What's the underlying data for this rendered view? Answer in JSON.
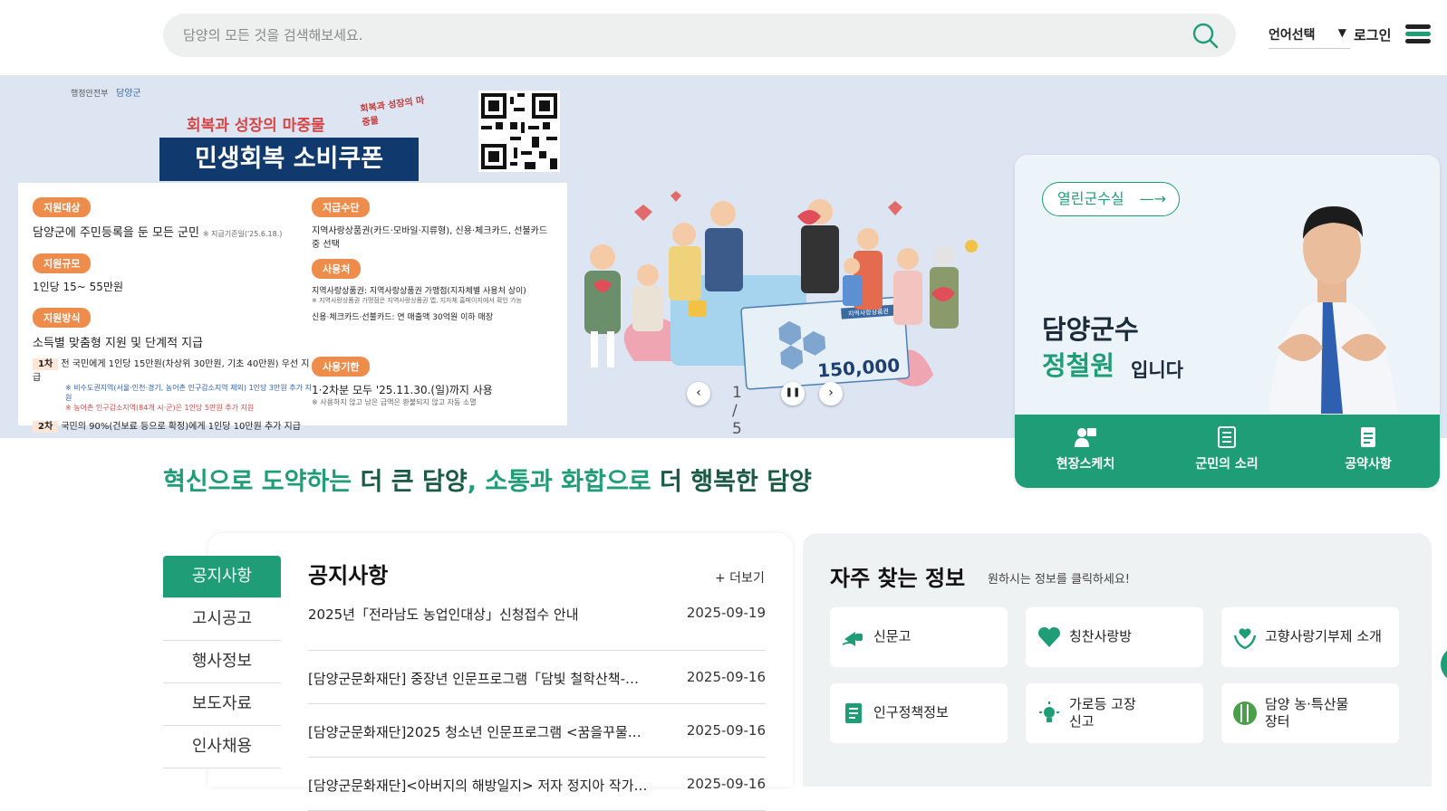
{
  "header": {
    "search_placeholder": "담양의 모든 것을 검색해보세요.",
    "lang_label": "언어선택",
    "lang_arrow": "▼",
    "login_label": "로그인"
  },
  "hero": {
    "poster": {
      "logo_ministry": "행정안전부",
      "logo_county": "담양군",
      "slogan": "회복과 성장의 마중물",
      "tagline": "회복과 성장의 마중물",
      "title": "민생회복 소비쿠폰",
      "sections": {
        "target": {
          "chip": "지원대상",
          "text": "담양군에 주민등록을 둔 모든 군민",
          "note": "※ 지급기준일('25.6.18.)"
        },
        "scale": {
          "chip": "지원규모",
          "text": "1인당 15~ 55만원"
        },
        "method": {
          "chip": "지원방식",
          "text": "소득별 맞춤형 지원 및 단계적 지급",
          "r1_tag": "1차",
          "r1_text": "전 국민에게 1인당 15만원(차상위 30만원, 기초 40만원) 우선 지급",
          "r1_note1": "※ 비수도권지역(서울·인천·경기, 농어촌 인구감소지역 제외) 1인당 3만원 추가 지원",
          "r1_note2": "※ 농어촌 인구감소지역(84개 시·군)은 1인당 5만원 추가 지원",
          "r2_tag": "2차",
          "r2_text": "국민의 90%(건보료 등으로 확정)에게 1인당 10만원 추가 지급"
        },
        "means": {
          "chip": "지급수단",
          "text": "지역사랑상품권(카드·모바일·지류형), 신용·체크카드, 선불카드 중 선택"
        },
        "usage": {
          "chip": "사용처",
          "l1": "지역사랑상품권: 지역사랑상품권 가맹점(지자체별 사용처 상이)",
          "l1_note": "※ 지역사랑상품권 가맹점은 지역사랑상품권 앱, 지자체 홈페이지에서 확인 가능",
          "l2": "신용·체크카드·선불카드: 연 매출액 30억원 이하 매장"
        },
        "period": {
          "chip": "사용기한",
          "text": "1·2차분 모두 '25.11.30.(일)까지 사용",
          "note": "※ 사용하지 않고 남은 금액은 환불되지 않고 자동 소멸"
        }
      }
    },
    "voucher": {
      "label": "지역사랑상품권",
      "amount": "150,000"
    },
    "counter": "1 / 5",
    "prev": "‹",
    "next": "›",
    "pause": "❚❚"
  },
  "mayor": {
    "pill": "열린군수실",
    "pill_arrow": "—→",
    "line1": "담양군수",
    "name": "정철원",
    "suffix": "입니다",
    "buttons": [
      "현장스케치",
      "군민의 소리",
      "공약사항"
    ]
  },
  "slogan": {
    "part1": "혁신으로 도약하는 ",
    "part2": "더 큰 담양",
    "part3": ", 소통과 화합으로 ",
    "part4": "더 행복한 담양"
  },
  "notice": {
    "tabs": [
      "공지사항",
      "고시공고",
      "행사정보",
      "보도자료",
      "인사채용"
    ],
    "title": "공지사항",
    "more": "+ 더보기",
    "rows": [
      {
        "title": "2025년「전라남도 농업인대상」신청접수 안내",
        "date": "2025-09-19"
      },
      {
        "title": "[담양군문화재단] 중장년 인문프로그램「담빛 철학산책-…",
        "date": "2025-09-16"
      },
      {
        "title": "[담양군문화재단]2025 청소년 인문프로그램 <꿈을꾸물…",
        "date": "2025-09-16"
      },
      {
        "title": "[담양군문화재단]<아버지의 해방일지> 저자 정지아 작가…",
        "date": "2025-09-16"
      }
    ]
  },
  "freq": {
    "title": "자주 찾는 정보",
    "subtitle": "원하시는 정보를 클릭하세요!",
    "items": [
      {
        "label": "신문고",
        "icon": "megaphone-hand-icon"
      },
      {
        "label": "칭찬사랑방",
        "icon": "heart-icon"
      },
      {
        "label": "고향사랑기부제 소개",
        "icon": "heart-hands-icon"
      },
      {
        "label": "인구정책정보",
        "icon": "document-icon"
      },
      {
        "label": "가로등 고장신고",
        "icon": "streetlight-icon"
      },
      {
        "label": "담양 농·특산물 장터",
        "icon": "bamboo-icon"
      }
    ]
  },
  "colors": {
    "accent": "#1f9d77",
    "navy": "#103a6d",
    "hero_bg": "#dde5f3",
    "chip": "#ee8d4b"
  }
}
